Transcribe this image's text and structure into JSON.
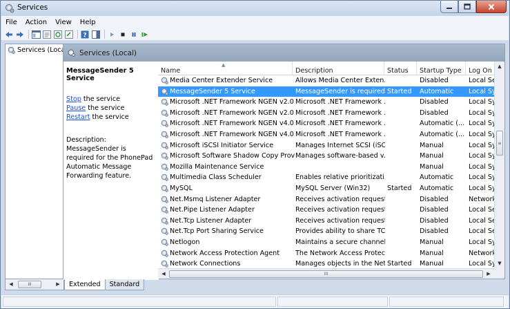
{
  "window": {
    "title": "Services"
  },
  "menu": [
    "File",
    "Action",
    "View",
    "Help"
  ],
  "toolbar": {
    "icons": [
      "back-icon",
      "forward-icon",
      "console-tree-icon",
      "properties-icon",
      "refresh-icon",
      "export-list-icon",
      "help-icon",
      "action-pane-icon",
      "start-service-icon",
      "stop-service-icon",
      "pause-service-icon",
      "restart-service-icon"
    ]
  },
  "tree": {
    "root_label": "Services (Loca"
  },
  "pane": {
    "header_title": "Services (Local)",
    "selected_service": "MessageSender 5 Service",
    "actions": [
      {
        "link": "Stop",
        "rest": " the service"
      },
      {
        "link": "Pause",
        "rest": " the service"
      },
      {
        "link": "Restart",
        "rest": " the service"
      }
    ],
    "description_label": "Description:",
    "description_text": "MessageSender is required for the PhonePad Automatic Message Forwarding feature."
  },
  "list": {
    "columns": {
      "name": "Name",
      "description": "Description",
      "status": "Status",
      "startup": "Startup Type",
      "logon": "Log On /"
    },
    "rows": [
      {
        "name": "Media Center Extender Service",
        "description": "Allows Media Center Exten...",
        "status": "",
        "startup": "Disabled",
        "logon": "Local Se"
      },
      {
        "name": "MessageSender 5 Service",
        "description": "MessageSender is required ...",
        "status": "Started",
        "startup": "Automatic",
        "logon": "Local Sy",
        "selected": true
      },
      {
        "name": "Microsoft .NET Framework NGEN v2.0.50...",
        "description": "Microsoft .NET Framework ...",
        "status": "",
        "startup": "Disabled",
        "logon": "Local Sy"
      },
      {
        "name": "Microsoft .NET Framework NGEN v2.0.50...",
        "description": "Microsoft .NET Framework ...",
        "status": "",
        "startup": "Disabled",
        "logon": "Local Sy"
      },
      {
        "name": "Microsoft .NET Framework NGEN v4.0.30...",
        "description": "Microsoft .NET Framework ...",
        "status": "",
        "startup": "Automatic (...",
        "logon": "Local Sy"
      },
      {
        "name": "Microsoft .NET Framework NGEN v4.0.30...",
        "description": "Microsoft .NET Framework ...",
        "status": "",
        "startup": "Automatic (...",
        "logon": "Local Sy"
      },
      {
        "name": "Microsoft iSCSI Initiator Service",
        "description": "Manages Internet SCSI (iSC...",
        "status": "",
        "startup": "Manual",
        "logon": "Local Sy"
      },
      {
        "name": "Microsoft Software Shadow Copy Provid...",
        "description": "Manages software-based v...",
        "status": "",
        "startup": "Manual",
        "logon": "Local Sy"
      },
      {
        "name": "Mozilla Maintenance Service",
        "description": "",
        "status": "",
        "startup": "Manual",
        "logon": "Local Sy"
      },
      {
        "name": "Multimedia Class Scheduler",
        "description": "Enables relative prioritizati...",
        "status": "",
        "startup": "Automatic",
        "logon": "Local Sy"
      },
      {
        "name": "MySQL",
        "description": "MySQL Server (Win32)",
        "status": "Started",
        "startup": "Automatic",
        "logon": "Local Sy"
      },
      {
        "name": "Net.Msmq Listener Adapter",
        "description": "Receives activation request...",
        "status": "",
        "startup": "Disabled",
        "logon": "Network"
      },
      {
        "name": "Net.Pipe Listener Adapter",
        "description": "Receives activation request...",
        "status": "",
        "startup": "Disabled",
        "logon": "Local Se"
      },
      {
        "name": "Net.Tcp Listener Adapter",
        "description": "Receives activation request...",
        "status": "",
        "startup": "Disabled",
        "logon": "Local Se"
      },
      {
        "name": "Net.Tcp Port Sharing Service",
        "description": "Provides ability to share TC...",
        "status": "",
        "startup": "Disabled",
        "logon": "Local Se"
      },
      {
        "name": "Netlogon",
        "description": "Maintains a secure channel ...",
        "status": "",
        "startup": "Manual",
        "logon": "Local Sy"
      },
      {
        "name": "Network Access Protection Agent",
        "description": "The Network Access Protect...",
        "status": "",
        "startup": "Manual",
        "logon": "Network"
      },
      {
        "name": "Network Connections",
        "description": "Manages objects in the Net...",
        "status": "Started",
        "startup": "Manual",
        "logon": "Local Sy"
      }
    ]
  },
  "scroll_labels": {
    "thumb_grip": "III",
    "thumb_grip_v": "≡"
  },
  "tabs": [
    {
      "label": "Extended",
      "active": true
    },
    {
      "label": "Standard",
      "active": false
    }
  ],
  "colors": {
    "selection": "#3399ff",
    "link": "#1a4fd6",
    "header": "#9fb0c6"
  }
}
